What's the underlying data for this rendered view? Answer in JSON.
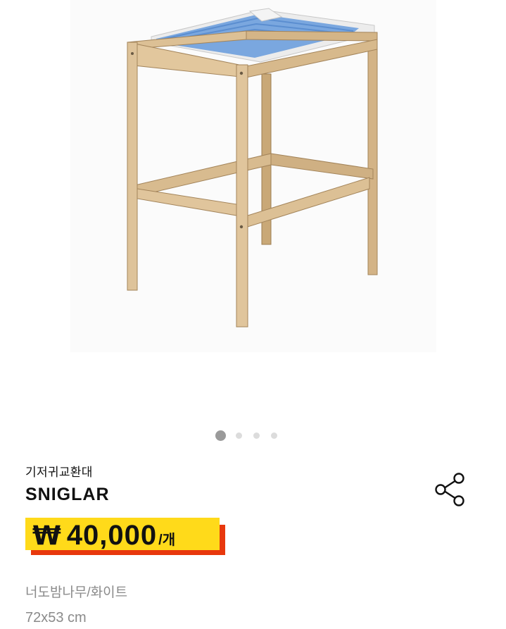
{
  "product": {
    "category": "기저귀교환대",
    "name": "SNIGLAR",
    "price": {
      "currency_symbol": "₩",
      "amount": "40,000",
      "unit": "/개"
    },
    "color": "너도밤나무/화이트",
    "size": "72x53 cm"
  },
  "carousel": {
    "total": 4,
    "active_index": 0
  },
  "icons": {
    "share": "share-icon"
  },
  "colors": {
    "price_highlight": "#ffda1a",
    "price_shadow": "#e8380d",
    "dot_active": "#9a9a9a",
    "dot_inactive": "#dcdcdc",
    "secondary_text": "#8a8a8a"
  }
}
